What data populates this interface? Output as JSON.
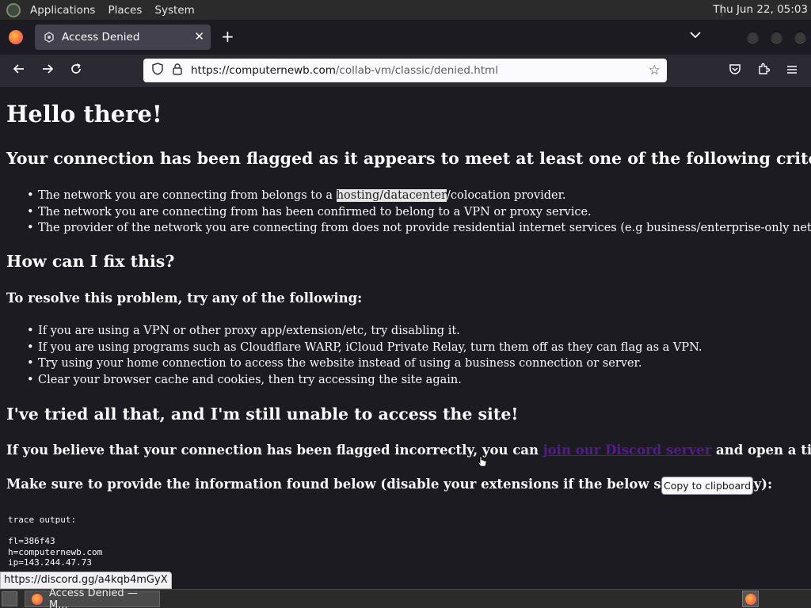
{
  "panel": {
    "menus": [
      "Applications",
      "Places",
      "System"
    ],
    "clock": "Thu Jun 22, 05:03"
  },
  "browser": {
    "tab_title": "Access Denied",
    "url_host": "https://computernewb.com",
    "url_path": "/collab-vm/classic/denied.html"
  },
  "page": {
    "h1": "Hello there!",
    "h2_criteria": "Your connection has been flagged as it appears to meet at least one of the following criteria:",
    "criteria": [
      {
        "pre": "The network you are connecting from belongs to a ",
        "hl": "hosting/datacenter",
        "post": "/colocation provider."
      },
      "The network you are connecting from has been confirmed to belong to a VPN or proxy service.",
      "The provider of the network you are connecting from does not provide residential internet services (e.g business/enterprise-only networks)."
    ],
    "h2_fix": "How can I fix this?",
    "h3_resolve": "To resolve this problem, try any of the following:",
    "fixes": [
      "If you are using a VPN or other proxy app/extension/etc, try disabling it.",
      "If you are using programs such as Cloudflare WARP, iCloud Private Relay, turn them off as they can flag as a VPN.",
      "Try using your home connection to access the website instead of using a business connection or server.",
      "Clear your browser cache and cookies, then try accessing the site again."
    ],
    "h2_tried": "I've tried all that, and I'm still unable to access the site!",
    "discord_pre": "If you believe that your connection has been flagged incorrectly, you can ",
    "discord_link": "join our Discord server",
    "discord_post": " and open a ticket.",
    "info_text": "Make sure to provide the information found below (disable your extensions if the below space is empty):",
    "copy_button": "Copy to clipboard",
    "trace": "trace output:\n\nfl=386f43\nh=computernewb.com\nip=143.244.47.73"
  },
  "status_link": "https://discord.gg/a4kqb4mGyX",
  "taskbar": {
    "task_label": "Access Denied — M..."
  },
  "colors": {
    "page_bg": "#1c1b22",
    "link_visited": "#551a8b",
    "toolbar_bg": "#2b2a33"
  }
}
